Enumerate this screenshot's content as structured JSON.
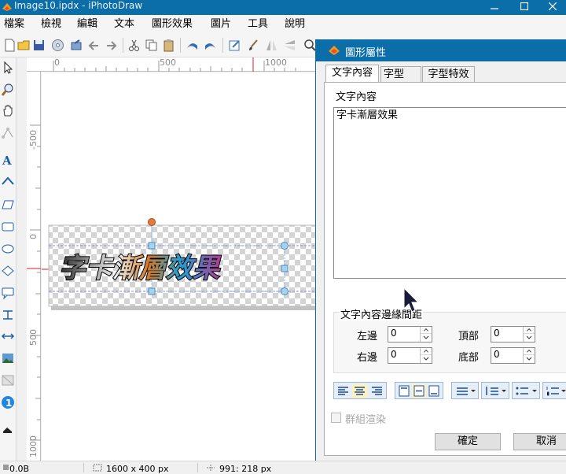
{
  "window": {
    "title": "Image10.ipdx - iPhotoDraw",
    "minimize_label": "—"
  },
  "menu": {
    "items": [
      "檔案",
      "檢視",
      "編輯",
      "文本",
      "圖形效果",
      "圖片",
      "工具",
      "說明"
    ]
  },
  "rulers": {
    "unit": "px",
    "h_ticks": [
      "0",
      "500",
      "1000"
    ],
    "v_ticks": [
      "-500",
      "0",
      "500",
      "1000"
    ]
  },
  "canvas": {
    "sample_text": "字卡漸層效果"
  },
  "dialog": {
    "title": "圖形屬性",
    "tabs": [
      "文字內容",
      "字型",
      "字型特效"
    ],
    "active_tab": 0,
    "text_section_label": "文字內容",
    "text_value": "字卡漸層效果",
    "margins_label": "文字內容邊緣間距",
    "margins": {
      "left_label": "左邊",
      "left_value": "0",
      "top_label": "頂部",
      "top_value": "0",
      "right_label": "右邊",
      "right_value": "0",
      "bottom_label": "底部",
      "bottom_value": "0"
    },
    "group_render_label": "群組渲染",
    "group_render_checked": false,
    "ok_label": "確定",
    "cancel_label": "取消"
  },
  "status": {
    "memory": "0.0B",
    "image_size": "1600 x 400 px",
    "cursor_pos": "991: 218 px"
  },
  "colors": {
    "titlebar": "#0b6ea8",
    "accent": "#0b6ea8",
    "selection_handle": "#a7d2ee",
    "rotate_handle": "#e57a3a",
    "guide_red": "#d62020"
  }
}
